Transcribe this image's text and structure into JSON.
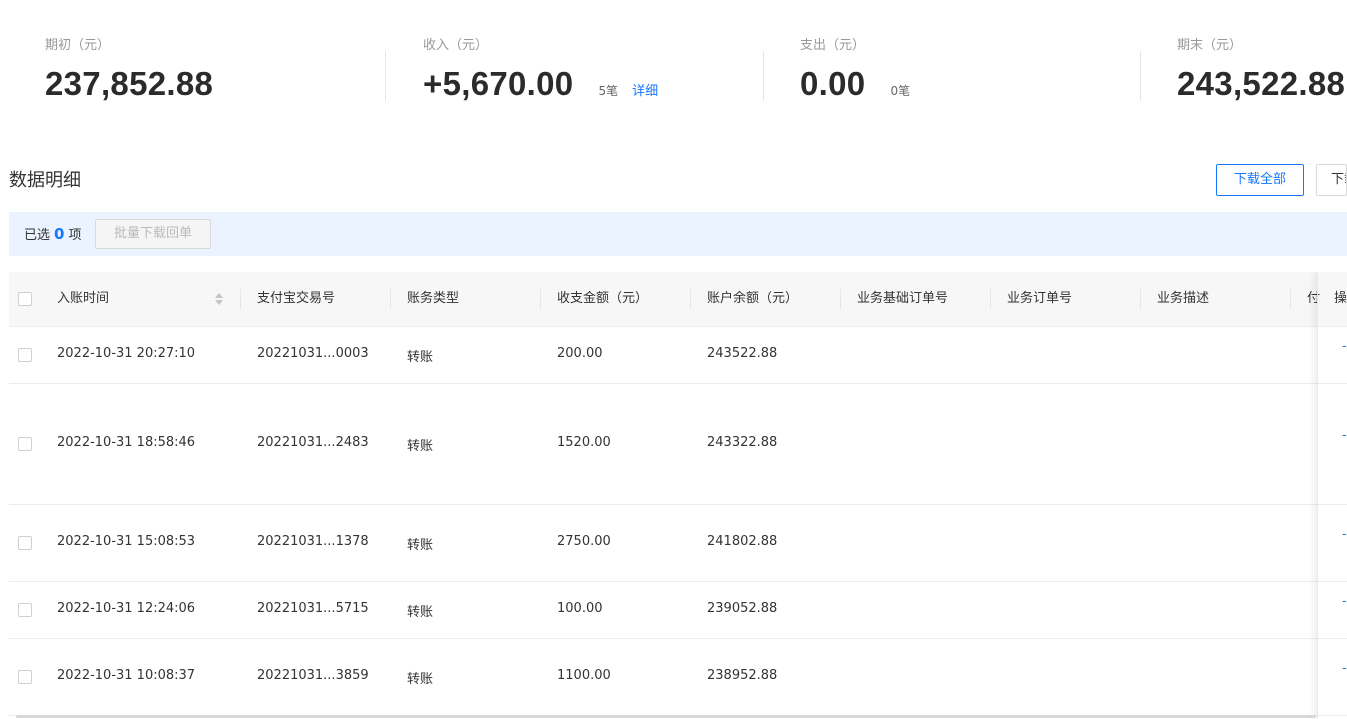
{
  "summary": {
    "opening": {
      "label": "期初（元）",
      "value": "237,852.88"
    },
    "income": {
      "label": "收入（元）",
      "value": "+5,670.00",
      "count": "5笔",
      "detail_link": "详细"
    },
    "expense": {
      "label": "支出（元）",
      "value": "0.00",
      "count": "0笔"
    },
    "closing": {
      "label": "期末（元）",
      "value": "243,522.88"
    }
  },
  "section": {
    "title": "数据明细",
    "download_all": "下载全部",
    "download_partial": "下载"
  },
  "selection": {
    "prefix": "已选",
    "count": "0",
    "suffix": "项",
    "batch_button": "批量下载回单"
  },
  "table": {
    "columns": [
      "入账时间",
      "支付宝交易号",
      "账务类型",
      "收支金额（元）",
      "账户余额（元）",
      "业务基础订单号",
      "业务订单号",
      "业务描述",
      "付",
      "操"
    ],
    "rows": [
      {
        "time": "2022-10-31 20:27:10",
        "trade_no": "20221031...0003",
        "type": "转账",
        "amount": "200.00",
        "balance": "243522.88",
        "op": "-"
      },
      {
        "time": "2022-10-31 18:58:46",
        "trade_no": "20221031...2483",
        "type": "转账",
        "amount": "1520.00",
        "balance": "243322.88",
        "op": "-"
      },
      {
        "time": "2022-10-31 15:08:53",
        "trade_no": "20221031...1378",
        "type": "转账",
        "amount": "2750.00",
        "balance": "241802.88",
        "op": "-"
      },
      {
        "time": "2022-10-31 12:24:06",
        "trade_no": "20221031...5715",
        "type": "转账",
        "amount": "100.00",
        "balance": "239052.88",
        "op": "-"
      },
      {
        "time": "2022-10-31 10:08:37",
        "trade_no": "20221031...3859",
        "type": "转账",
        "amount": "1100.00",
        "balance": "238952.88",
        "op": "-"
      }
    ]
  },
  "colors": {
    "accent": "#1677ff",
    "select_bar_bg": "#eaf3ff",
    "header_bg": "#f7f7f7"
  }
}
